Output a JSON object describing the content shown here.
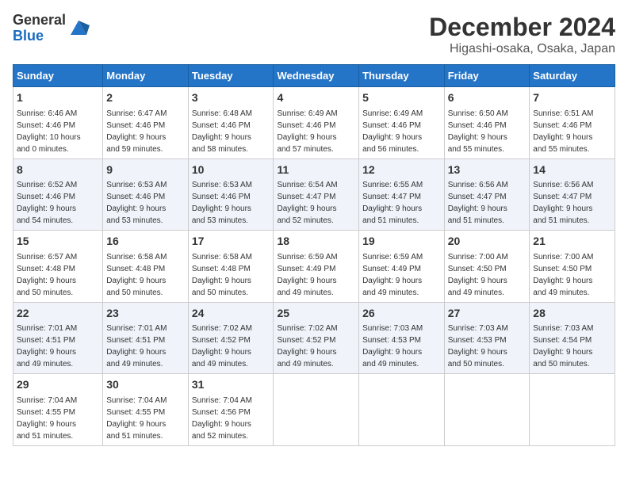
{
  "logo": {
    "general": "General",
    "blue": "Blue"
  },
  "title": "December 2024",
  "subtitle": "Higashi-osaka, Osaka, Japan",
  "headers": [
    "Sunday",
    "Monday",
    "Tuesday",
    "Wednesday",
    "Thursday",
    "Friday",
    "Saturday"
  ],
  "weeks": [
    [
      {
        "day": "1",
        "info": "Sunrise: 6:46 AM\nSunset: 4:46 PM\nDaylight: 10 hours\nand 0 minutes."
      },
      {
        "day": "2",
        "info": "Sunrise: 6:47 AM\nSunset: 4:46 PM\nDaylight: 9 hours\nand 59 minutes."
      },
      {
        "day": "3",
        "info": "Sunrise: 6:48 AM\nSunset: 4:46 PM\nDaylight: 9 hours\nand 58 minutes."
      },
      {
        "day": "4",
        "info": "Sunrise: 6:49 AM\nSunset: 4:46 PM\nDaylight: 9 hours\nand 57 minutes."
      },
      {
        "day": "5",
        "info": "Sunrise: 6:49 AM\nSunset: 4:46 PM\nDaylight: 9 hours\nand 56 minutes."
      },
      {
        "day": "6",
        "info": "Sunrise: 6:50 AM\nSunset: 4:46 PM\nDaylight: 9 hours\nand 55 minutes."
      },
      {
        "day": "7",
        "info": "Sunrise: 6:51 AM\nSunset: 4:46 PM\nDaylight: 9 hours\nand 55 minutes."
      }
    ],
    [
      {
        "day": "8",
        "info": "Sunrise: 6:52 AM\nSunset: 4:46 PM\nDaylight: 9 hours\nand 54 minutes."
      },
      {
        "day": "9",
        "info": "Sunrise: 6:53 AM\nSunset: 4:46 PM\nDaylight: 9 hours\nand 53 minutes."
      },
      {
        "day": "10",
        "info": "Sunrise: 6:53 AM\nSunset: 4:46 PM\nDaylight: 9 hours\nand 53 minutes."
      },
      {
        "day": "11",
        "info": "Sunrise: 6:54 AM\nSunset: 4:47 PM\nDaylight: 9 hours\nand 52 minutes."
      },
      {
        "day": "12",
        "info": "Sunrise: 6:55 AM\nSunset: 4:47 PM\nDaylight: 9 hours\nand 51 minutes."
      },
      {
        "day": "13",
        "info": "Sunrise: 6:56 AM\nSunset: 4:47 PM\nDaylight: 9 hours\nand 51 minutes."
      },
      {
        "day": "14",
        "info": "Sunrise: 6:56 AM\nSunset: 4:47 PM\nDaylight: 9 hours\nand 51 minutes."
      }
    ],
    [
      {
        "day": "15",
        "info": "Sunrise: 6:57 AM\nSunset: 4:48 PM\nDaylight: 9 hours\nand 50 minutes."
      },
      {
        "day": "16",
        "info": "Sunrise: 6:58 AM\nSunset: 4:48 PM\nDaylight: 9 hours\nand 50 minutes."
      },
      {
        "day": "17",
        "info": "Sunrise: 6:58 AM\nSunset: 4:48 PM\nDaylight: 9 hours\nand 50 minutes."
      },
      {
        "day": "18",
        "info": "Sunrise: 6:59 AM\nSunset: 4:49 PM\nDaylight: 9 hours\nand 49 minutes."
      },
      {
        "day": "19",
        "info": "Sunrise: 6:59 AM\nSunset: 4:49 PM\nDaylight: 9 hours\nand 49 minutes."
      },
      {
        "day": "20",
        "info": "Sunrise: 7:00 AM\nSunset: 4:50 PM\nDaylight: 9 hours\nand 49 minutes."
      },
      {
        "day": "21",
        "info": "Sunrise: 7:00 AM\nSunset: 4:50 PM\nDaylight: 9 hours\nand 49 minutes."
      }
    ],
    [
      {
        "day": "22",
        "info": "Sunrise: 7:01 AM\nSunset: 4:51 PM\nDaylight: 9 hours\nand 49 minutes."
      },
      {
        "day": "23",
        "info": "Sunrise: 7:01 AM\nSunset: 4:51 PM\nDaylight: 9 hours\nand 49 minutes."
      },
      {
        "day": "24",
        "info": "Sunrise: 7:02 AM\nSunset: 4:52 PM\nDaylight: 9 hours\nand 49 minutes."
      },
      {
        "day": "25",
        "info": "Sunrise: 7:02 AM\nSunset: 4:52 PM\nDaylight: 9 hours\nand 49 minutes."
      },
      {
        "day": "26",
        "info": "Sunrise: 7:03 AM\nSunset: 4:53 PM\nDaylight: 9 hours\nand 49 minutes."
      },
      {
        "day": "27",
        "info": "Sunrise: 7:03 AM\nSunset: 4:53 PM\nDaylight: 9 hours\nand 50 minutes."
      },
      {
        "day": "28",
        "info": "Sunrise: 7:03 AM\nSunset: 4:54 PM\nDaylight: 9 hours\nand 50 minutes."
      }
    ],
    [
      {
        "day": "29",
        "info": "Sunrise: 7:04 AM\nSunset: 4:55 PM\nDaylight: 9 hours\nand 51 minutes."
      },
      {
        "day": "30",
        "info": "Sunrise: 7:04 AM\nSunset: 4:55 PM\nDaylight: 9 hours\nand 51 minutes."
      },
      {
        "day": "31",
        "info": "Sunrise: 7:04 AM\nSunset: 4:56 PM\nDaylight: 9 hours\nand 52 minutes."
      },
      {
        "day": "",
        "info": ""
      },
      {
        "day": "",
        "info": ""
      },
      {
        "day": "",
        "info": ""
      },
      {
        "day": "",
        "info": ""
      }
    ]
  ]
}
